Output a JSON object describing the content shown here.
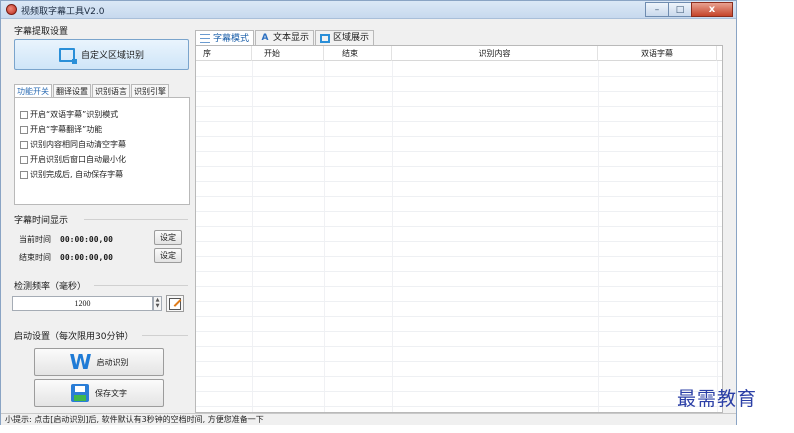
{
  "window": {
    "title": "视频取字幕工具V2.0",
    "controls": {
      "minimize": "–",
      "maximize": "□",
      "close": "x"
    }
  },
  "left": {
    "extract_section": {
      "title": "字幕提取设置",
      "custom_region_button": "自定义区域识别"
    },
    "tabs": [
      "功能开关",
      "翻译设置",
      "识别语言",
      "识别引擎"
    ],
    "options": [
      "开启“双语字幕”识别模式",
      "开启“字幕翻译”功能",
      "识别内容相同自动清空字幕",
      "开启识别后窗口自动最小化",
      "识别完成后, 自动保存字幕"
    ],
    "time_section": {
      "title": "字幕时间显示",
      "rows": [
        {
          "label": "当前时间",
          "value": "00:00:00,00",
          "button": "设定"
        },
        {
          "label": "结束时间",
          "value": "00:00:00,00",
          "button": "设定"
        }
      ]
    },
    "frequency_section": {
      "title": "检测频率（毫秒）",
      "value": "1200"
    },
    "start_section": {
      "title": "启动设置（每次限用30分钟）",
      "start_button": "启动识别",
      "save_button": "保存文字"
    }
  },
  "right": {
    "tabs": [
      "字幕模式",
      "文本显示",
      "区域展示"
    ],
    "columns": [
      "序",
      "开始",
      "结束",
      "识别内容",
      "双语字幕"
    ]
  },
  "statusbar": {
    "text": "小提示: 点击[启动识别]后, 软件默认有3秒钟的空档时间, 方便您准备一下"
  },
  "watermark": "最需教育",
  "colors": {
    "accent": "#2a8fd8",
    "active_tab_text": "#2d6db4",
    "close_button": "#c5442a",
    "watermark": "#2b3fa6"
  }
}
